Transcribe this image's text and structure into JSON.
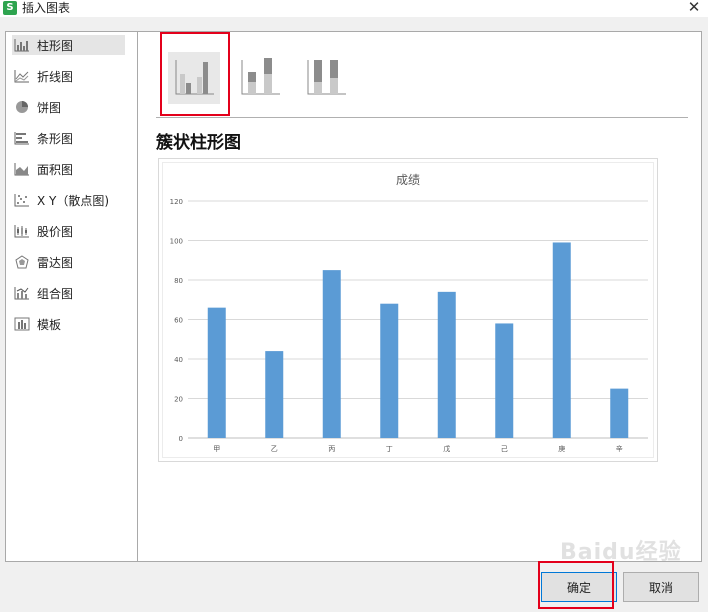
{
  "window": {
    "title": "插入图表",
    "app_icon_letter": "S"
  },
  "sidebar": {
    "items": [
      {
        "label": "柱形图",
        "icon": "column-chart-icon",
        "active": true
      },
      {
        "label": "折线图",
        "icon": "line-chart-icon"
      },
      {
        "label": "饼图",
        "icon": "pie-chart-icon"
      },
      {
        "label": "条形图",
        "icon": "bar-chart-icon"
      },
      {
        "label": "面积图",
        "icon": "area-chart-icon"
      },
      {
        "label": "X Y（散点图)",
        "icon": "scatter-chart-icon"
      },
      {
        "label": "股价图",
        "icon": "stock-chart-icon"
      },
      {
        "label": "雷达图",
        "icon": "radar-chart-icon"
      },
      {
        "label": "组合图",
        "icon": "combo-chart-icon"
      },
      {
        "label": "模板",
        "icon": "template-icon"
      }
    ]
  },
  "main": {
    "subtypes": [
      "clustered-column-icon",
      "stacked-column-icon",
      "percent-stacked-column-icon"
    ],
    "selected_type_title": "簇状柱形图"
  },
  "chart_data": {
    "type": "bar",
    "title": "成绩",
    "categories": [
      "甲",
      "乙",
      "丙",
      "丁",
      "戊",
      "己",
      "庚",
      "辛"
    ],
    "values": [
      66,
      44,
      85,
      68,
      74,
      58,
      99,
      25
    ],
    "ylim": [
      0,
      120
    ],
    "yticks": [
      "0",
      "20",
      "40",
      "60",
      "80",
      "100",
      "120"
    ],
    "grid": true,
    "bar_color": "#5b9bd5"
  },
  "buttons": {
    "ok": "确定",
    "cancel": "取消"
  },
  "watermark": "Baidu经验",
  "colors": {
    "highlight": "#e3001b",
    "selected_bg": "#e5e5e5"
  }
}
